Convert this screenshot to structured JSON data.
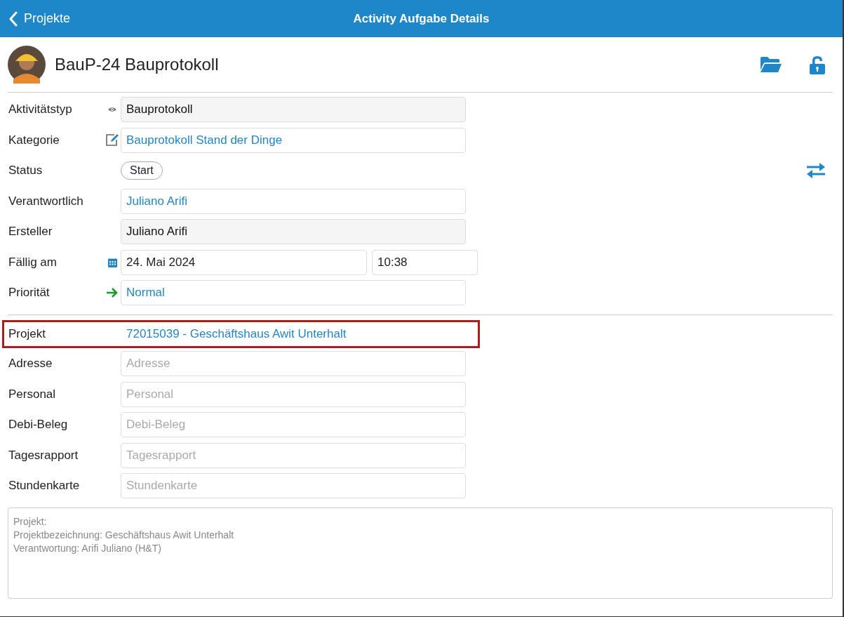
{
  "nav_bar": {
    "back_label": "Projekte",
    "title": "Activity Aufgabe Details"
  },
  "record": {
    "title": "BauP-24 Bauprotokoll"
  },
  "details": [
    {
      "kind": "type",
      "label": "Aktivitätstyp",
      "value": "Bauprotokoll"
    },
    {
      "kind": "category",
      "label": "Kategorie",
      "value": "Bauprotokoll Stand der Dinge"
    },
    {
      "kind": "status",
      "label": "Status",
      "value": "Start"
    },
    {
      "kind": "link",
      "label": "Verantwortlich",
      "value": "Juliano Arifi"
    },
    {
      "kind": "readonly",
      "label": "Ersteller",
      "value": "Juliano Arifi"
    },
    {
      "kind": "date",
      "label": "Fällig am",
      "value": "24. Mai 2024",
      "time": "10:38"
    },
    {
      "kind": "priority",
      "label": "Priorität",
      "value": "Normal"
    }
  ],
  "links": [
    {
      "label": "Projekt",
      "value": "72015039 - Geschäftshaus Awit Unterhalt",
      "highlighted": true
    },
    {
      "label": "Adresse",
      "placeholder": "Adresse",
      "highlighted": false
    },
    {
      "label": "Personal",
      "placeholder": "Personal",
      "highlighted": false
    },
    {
      "label": "Debi-Beleg",
      "placeholder": "Debi-Beleg",
      "highlighted": false
    },
    {
      "label": "Tagesrapport",
      "placeholder": "Tagesrapport",
      "highlighted": false
    },
    {
      "label": "Stundenkarte",
      "placeholder": "Stundenkarte",
      "highlighted": false
    }
  ],
  "notes": [
    "Projekt:",
    "Projektbezeichnung: Geschäftshaus Awit Unterhalt",
    "Verantwortung: Arifi Juliano (H&T)"
  ]
}
